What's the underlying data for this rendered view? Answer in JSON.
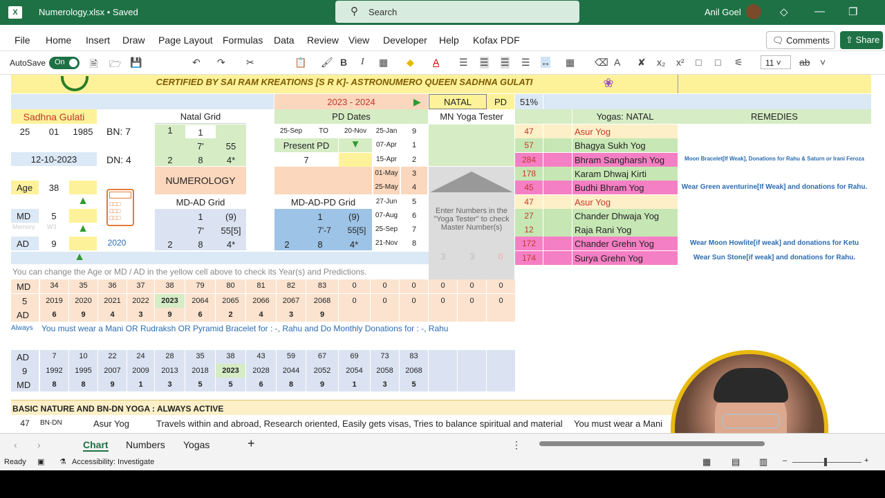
{
  "titlebar": {
    "filename": "Numerology.xlsx • Saved",
    "search_placeholder": "Search",
    "user": "Anil Goel"
  },
  "menu": [
    "File",
    "Home",
    "Insert",
    "Draw",
    "Page Layout",
    "Formulas",
    "Data",
    "Review",
    "View",
    "Developer",
    "Help",
    "Kofax PDF"
  ],
  "comments_label": "Comments",
  "share_label": "Share",
  "ribbon": {
    "autosave": "AutoSave",
    "toggle": "On",
    "font_size": "11"
  },
  "banner": "CERTIFIED BY SAI RAM KREATIONS [S R K]- ASTRONUMERO QUEEN SADHNA GULATI",
  "top": {
    "year_range": "2023 - 2024",
    "natal": "NATAL",
    "pd": "PD",
    "percent": "51%",
    "pd_dates": "PD Dates",
    "mn_yoga": "MN Yoga Tester",
    "yogas_natal": "Yogas: NATAL",
    "remedies": "REMEDIES"
  },
  "left": {
    "name": "Sadhna Gulati",
    "day": "25",
    "month": "01",
    "year": "1985",
    "bn": "BN: 7",
    "dn": "DN: 4",
    "date": "12-10-2023",
    "age_label": "Age",
    "age": "38",
    "md_label": "MD",
    "md": "5",
    "ad_label": "AD",
    "ad": "9",
    "calc_year": "2020",
    "memory": "Memory",
    "w3": "W3"
  },
  "natal_grid": {
    "title": "Natal Grid",
    "r1": [
      "1",
      "",
      ""
    ],
    "r2": [
      "",
      "7'",
      "55"
    ],
    "r3": [
      "2",
      "8",
      "4*"
    ],
    "numerology": "NUMEROLOGY",
    "mdad_title": "MD-AD Grid",
    "m1": [
      "",
      "1",
      "(9)"
    ],
    "m2": [
      "",
      "7'",
      "55[5]"
    ],
    "m3": [
      "2",
      "8",
      "4*"
    ]
  },
  "pd": {
    "d1": "25-Sep",
    "to": "TO",
    "d2": "20-Nov",
    "present": "Present PD",
    "present_val": "7",
    "grid_title": "MD-AD-PD Grid",
    "p1": [
      "",
      "1",
      "(9)"
    ],
    "p2": [
      "",
      "7'-7",
      "55[5]"
    ],
    "p3": [
      "2",
      "8",
      "4*"
    ]
  },
  "dates": [
    [
      "25-Jan",
      "9"
    ],
    [
      "07-Apr",
      "1"
    ],
    [
      "15-Apr",
      "2"
    ],
    [
      "01-May",
      "3"
    ],
    [
      "25-May",
      "4"
    ],
    [
      "27-Jun",
      "5"
    ],
    [
      "07-Aug",
      "6"
    ],
    [
      "25-Sep",
      "7"
    ],
    [
      "21-Nov",
      "8"
    ]
  ],
  "yoga_tester_text": "Enter Numbers in the \"Yoga Tester\" to check Master Number(s)",
  "yoga_tester_vals": [
    "3",
    "3",
    "0"
  ],
  "yogas": [
    {
      "num": "47",
      "name": "Asur Yog",
      "color": "#fdf0c8",
      "remedy": ""
    },
    {
      "num": "57",
      "name": "Bhagya Sukh Yog",
      "color": "#c6e7b4",
      "remedy": ""
    },
    {
      "num": "284",
      "name": "Bhram Sangharsh Yog",
      "color": "#f57fc4",
      "remedy": "Moon Bracelet[If Weak], Donations for Rahu & Saturn or Irani Feroza"
    },
    {
      "num": "178",
      "name": "Karam Dhwaj Kirti",
      "color": "#c6e7b4",
      "remedy": ""
    },
    {
      "num": "45",
      "name": "Budhi Bhram Yog",
      "color": "#f57fc4",
      "remedy": "Wear Green aventurine[If Weak] and donations for Rahu."
    },
    {
      "num": "47",
      "name": "Asur Yog",
      "color": "#fdf0c8",
      "remedy": ""
    },
    {
      "num": "27",
      "name": "Chander Dhwaja Yog",
      "color": "#c6e7b4",
      "remedy": ""
    },
    {
      "num": "12",
      "name": "Raja Rani Yog",
      "color": "#c6e7b4",
      "remedy": ""
    },
    {
      "num": "172",
      "name": "Chander Grehn Yog",
      "color": "#f57fc4",
      "remedy": "Wear Moon Howlite[if weak] and donations for Ketu"
    },
    {
      "num": "174",
      "name": "Surya Grehn Yog",
      "color": "#f57fc4",
      "remedy": "Wear Sun Stone[if weak] and donations for Rahu."
    }
  ],
  "hint": "You can change the Age or MD / AD in the yellow cell above to check its Year(s) and Predictions.",
  "md_table": {
    "h1": "MD",
    "h2": "5",
    "h3": "AD",
    "ages": [
      "34",
      "35",
      "36",
      "37",
      "38",
      "79",
      "80",
      "81",
      "82",
      "83",
      "0",
      "0",
      "0",
      "0",
      "0",
      "0"
    ],
    "years": [
      "2019",
      "2020",
      "2021",
      "2022",
      "2023",
      "2064",
      "2065",
      "2066",
      "2067",
      "2068",
      "0",
      "0",
      "0",
      "0",
      "0",
      "0"
    ],
    "ads": [
      "6",
      "9",
      "4",
      "3",
      "9",
      "6",
      "2",
      "4",
      "3",
      "9",
      "",
      "",
      "",
      "",
      "",
      ""
    ]
  },
  "always_label": "Always",
  "always_text": "You must wear a Mani OR Rudraksh OR Pyramid Bracelet for : -, Rahu and Do Monthly Donations for : -, Rahu",
  "ad_table": {
    "h1": "AD",
    "h2": "9",
    "h3": "MD",
    "ages": [
      "7",
      "10",
      "22",
      "24",
      "28",
      "35",
      "38",
      "43",
      "59",
      "67",
      "69",
      "73",
      "83"
    ],
    "years": [
      "1992",
      "1995",
      "2007",
      "2009",
      "2013",
      "2018",
      "2023",
      "2028",
      "2044",
      "2052",
      "2054",
      "2058",
      "2068"
    ],
    "mds": [
      "8",
      "8",
      "9",
      "1",
      "3",
      "5",
      "5",
      "6",
      "8",
      "9",
      "1",
      "3",
      "5"
    ]
  },
  "basic_title": "BASIC NATURE AND BN-DN YOGA : ALWAYS ACTIVE",
  "basic_row": {
    "num": "47",
    "bndn": "BN-DN",
    "yoga": "Asur Yog",
    "desc": "Travels within and abroad, Research oriented, Easily gets visas, Tries to balance spiritual and material",
    "remedy": "You must wear a Mani"
  },
  "tabs": [
    "Chart",
    "Numbers",
    "Yogas"
  ],
  "status": {
    "ready": "Ready",
    "accessibility": "Accessibility: Investigate"
  }
}
